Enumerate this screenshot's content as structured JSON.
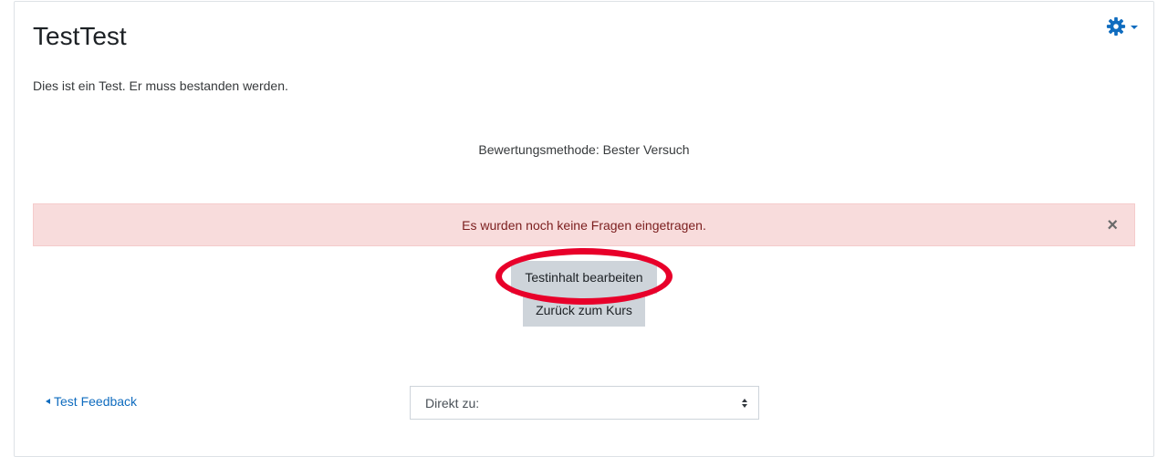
{
  "page": {
    "title": "TestTest",
    "intro": "Dies ist ein Test. Er muss bestanden werden.",
    "grading_method": "Bewertungsmethode: Bester Versuch"
  },
  "settings_menu": {
    "icon": "gear-icon",
    "color": "#0f6cbf"
  },
  "alert": {
    "message": "Es wurden noch keine Fragen eingetragen.",
    "close_label": "×",
    "background": "#f8dcdc",
    "text_color": "#7b1e1e"
  },
  "actions": {
    "edit_label": "Testinhalt bearbeiten",
    "back_label": "Zurück zum Kurs"
  },
  "annotation": {
    "color": "#e8002a"
  },
  "navigation": {
    "prev_link": "Test Feedback",
    "jump_placeholder": "Direkt zu:"
  }
}
